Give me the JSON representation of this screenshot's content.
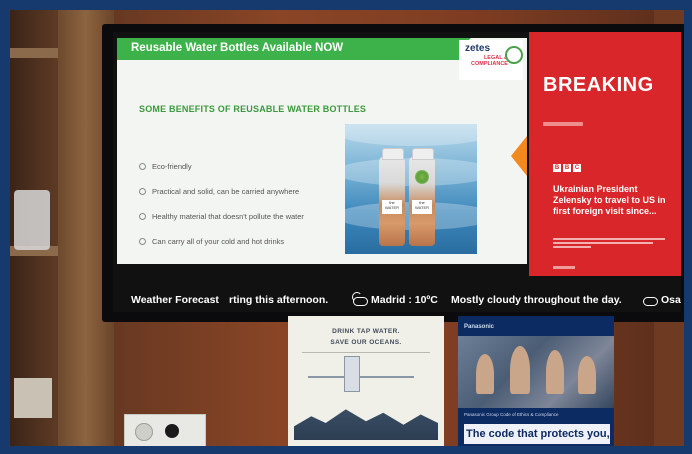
{
  "slide": {
    "title": "Reusable Water Bottles Available NOW",
    "subtitle": "SOME BENEFITS OF REUSABLE WATER BOTTLES",
    "benefits": [
      "Eco-friendly",
      "Practical and solid, can be carried anywhere",
      "Healthy material that doesn't pollute the water",
      "Can carry all of your cold and hot drinks"
    ],
    "logo": {
      "brand": "zetes",
      "line1": "LEGAL &",
      "line2": "COMPLIANCE"
    },
    "bottle_label": "the WATER"
  },
  "news": {
    "banner": "BREAKING",
    "source": [
      "B",
      "B",
      "C"
    ],
    "headline": "Ukrainian President Zelensky to travel to US in first foreign visit since..."
  },
  "ticker": {
    "label": "Weather Forecast",
    "text1": "rting this afternoon.",
    "city": "Madrid : 10ºC",
    "text2": "Mostly cloudy throughout the day.",
    "city2": "Osal"
  },
  "poster_left": {
    "title_line1": "DRINK TAP WATER.",
    "title_line2": "SAVE OUR OCEANS."
  },
  "poster_right": {
    "brand": "Panasonic",
    "sub": "Panasonic Group Code of Ethics & Compliance",
    "headline": "The code that protects you,"
  },
  "colors": {
    "slide_green": "#3db24a",
    "breaking_red": "#d8262a",
    "frame_blue": "#163a6e",
    "poster_navy": "#0d2b63"
  }
}
